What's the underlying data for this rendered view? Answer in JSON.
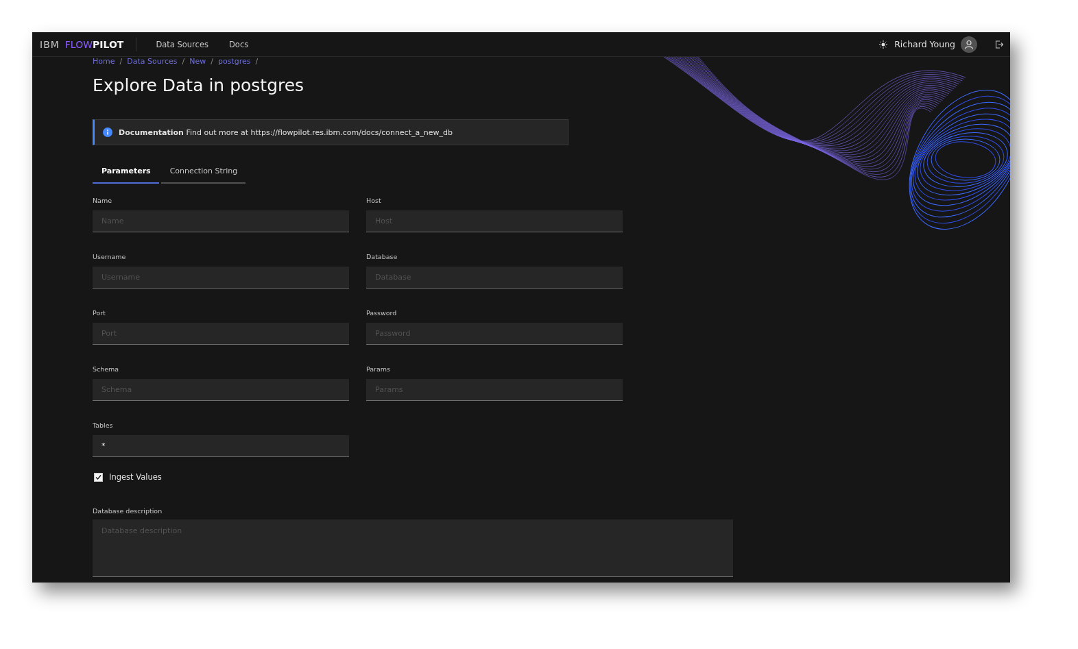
{
  "header": {
    "brand": [
      {
        "text": "IBM",
        "kind": "plain"
      },
      {
        "text": "FLOW",
        "kind": "accent"
      },
      {
        "text": "PILOT",
        "kind": "strong"
      }
    ],
    "nav": [
      "Data Sources",
      "Docs"
    ],
    "user": "Richard Young"
  },
  "breadcrumb": [
    {
      "label": "Home",
      "separator": "/"
    },
    {
      "label": "Data Sources",
      "separator": "/"
    },
    {
      "label": "New",
      "separator": "/"
    },
    {
      "label": "postgres",
      "separator": "/"
    }
  ],
  "title": "Explore Data in postgres",
  "notification": {
    "title": "Documentation",
    "text": "Find out more at https://flowpilot.res.ibm.com/docs/connect_a_new_db"
  },
  "tabs": [
    {
      "label": "Parameters",
      "selected": true
    },
    {
      "label": "Connection String",
      "selected": false
    }
  ],
  "fields": [
    {
      "label": "Name",
      "placeholder": "Name"
    },
    {
      "label": "Host",
      "placeholder": "Host"
    },
    {
      "label": "Username",
      "placeholder": "Username"
    },
    {
      "label": "Database",
      "placeholder": "Database"
    },
    {
      "label": "Port",
      "placeholder": "Port"
    },
    {
      "label": "Password",
      "placeholder": "Password"
    },
    {
      "label": "Schema",
      "placeholder": "Schema"
    },
    {
      "label": "Params",
      "placeholder": "Params"
    },
    {
      "label": "Tables",
      "value": "*"
    }
  ],
  "checkbox": {
    "label": "Ingest Values",
    "checked": true
  },
  "description": {
    "label": "Database description",
    "placeholder": "Database description"
  }
}
